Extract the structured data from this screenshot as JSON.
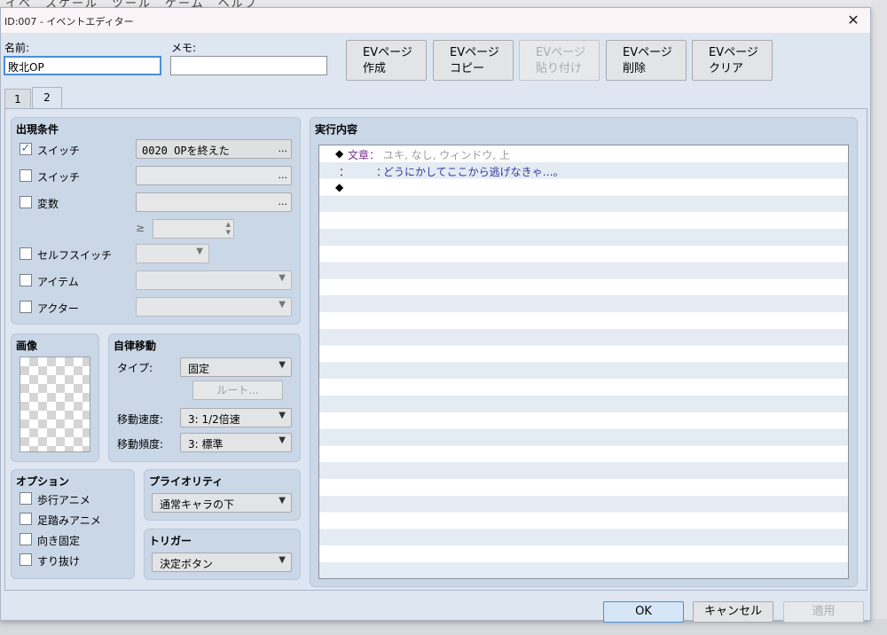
{
  "background_menu_text": "イベ　スケール　ツール　ゲーム　ヘルプ",
  "window": {
    "title": "ID:007 - イベントエディター"
  },
  "header": {
    "name_label": "名前:",
    "name_value": "敗北OP",
    "memo_label": "メモ:",
    "memo_value": ""
  },
  "ev_buttons": [
    {
      "line1": "EVページ",
      "line2": "作成",
      "enabled": true
    },
    {
      "line1": "EVページ",
      "line2": "コピー",
      "enabled": true
    },
    {
      "line1": "EVページ",
      "line2": "貼り付け",
      "enabled": false
    },
    {
      "line1": "EVページ",
      "line2": "削除",
      "enabled": true
    },
    {
      "line1": "EVページ",
      "line2": "クリア",
      "enabled": true
    }
  ],
  "tabs": [
    {
      "label": "1"
    },
    {
      "label": "2",
      "active": true
    }
  ],
  "conditions": {
    "title": "出現条件",
    "switch1": {
      "label": "スイッチ",
      "checked": true,
      "value": "0020 OPを終えた"
    },
    "switch2": {
      "label": "スイッチ",
      "checked": false,
      "value": ""
    },
    "variable": {
      "label": "変数",
      "checked": false,
      "value": "",
      "gte": "≥"
    },
    "self_switch": {
      "label": "セルフスイッチ",
      "checked": false
    },
    "item": {
      "label": "アイテム",
      "checked": false
    },
    "actor": {
      "label": "アクター",
      "checked": false
    },
    "dots": "..."
  },
  "image": {
    "title": "画像"
  },
  "autonomous": {
    "title": "自律移動",
    "type_label": "タイプ:",
    "type_value": "固定",
    "route_button": "ルート...",
    "speed_label": "移動速度:",
    "speed_value": "3: 1/2倍速",
    "freq_label": "移動頻度:",
    "freq_value": "3: 標準"
  },
  "options": {
    "title": "オプション",
    "walking": "歩行アニメ",
    "stepping": "足踏みアニメ",
    "direction_fix": "向き固定",
    "through": "すり抜け"
  },
  "priority": {
    "title": "プライオリティ",
    "value": "通常キャラの下"
  },
  "trigger": {
    "title": "トリガー",
    "value": "決定ボタン"
  },
  "contents": {
    "title": "実行内容",
    "line1_mark": "◆",
    "line1_cmd": "文章",
    "line1_sep": "：",
    "line1_args": "ユキ, なし, ウィンドウ, 上",
    "line2_colon": "：",
    "line2_colon2": "：",
    "line2_text": "どうにかしてここから逃げなきゃ…。",
    "line3_mark": "◆"
  },
  "footer": {
    "ok": "OK",
    "cancel": "キャンセル",
    "apply": "適用"
  }
}
